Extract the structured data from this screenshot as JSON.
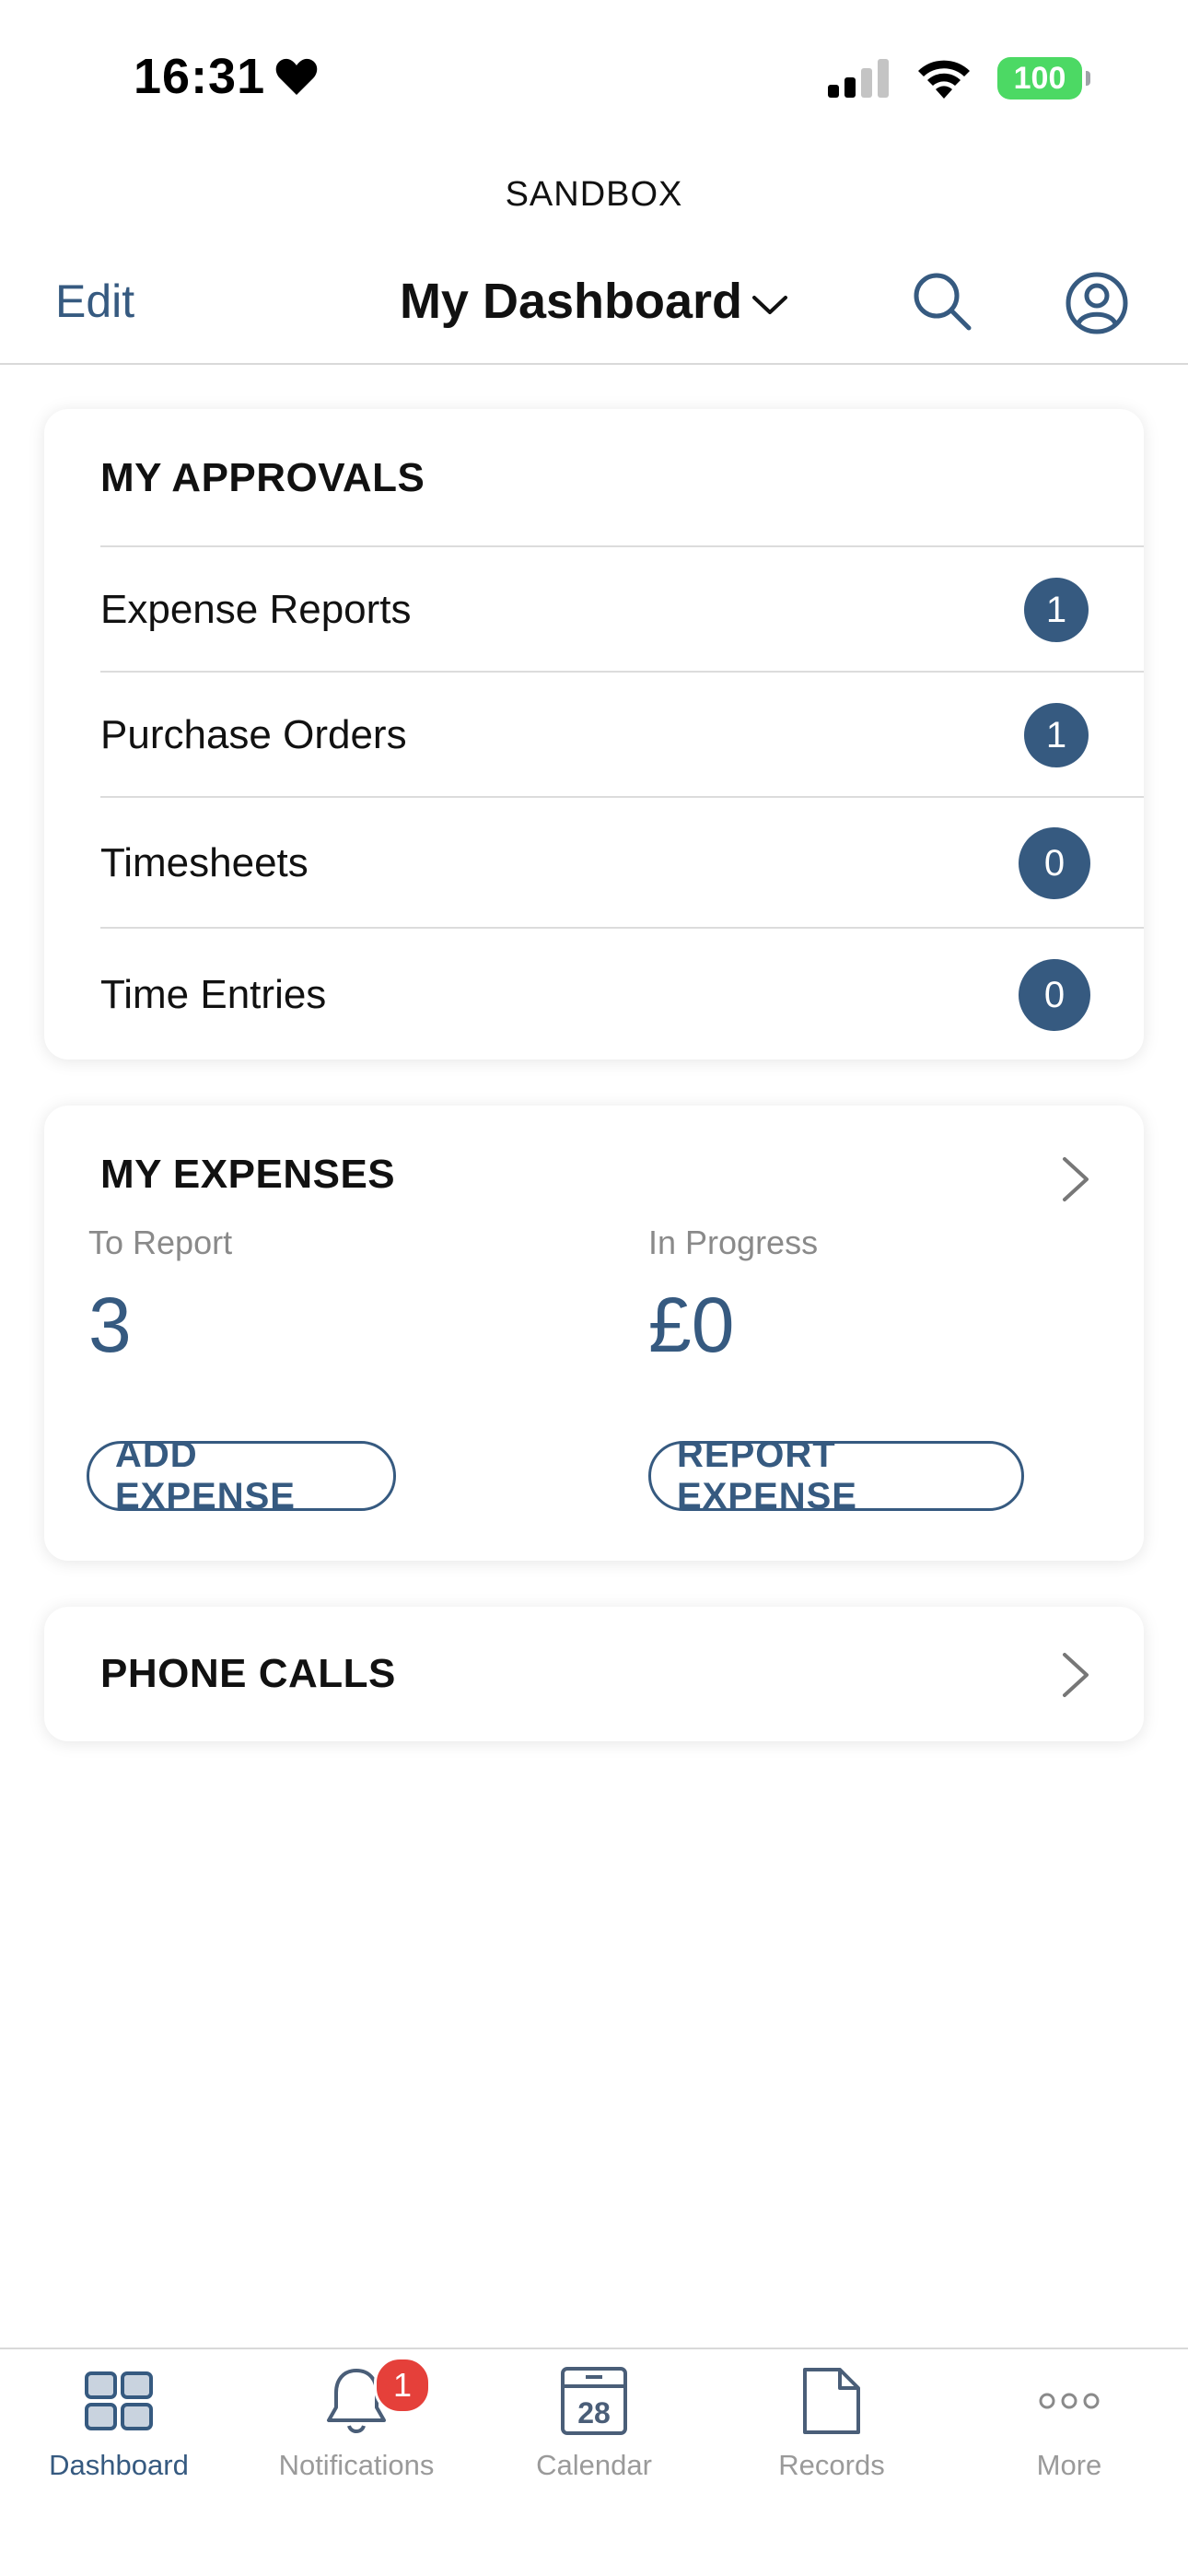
{
  "status_bar": {
    "time": "16:31",
    "battery": "100"
  },
  "environment_label": "SANDBOX",
  "nav": {
    "edit_label": "Edit",
    "title": "My Dashboard"
  },
  "approvals": {
    "heading": "MY APPROVALS",
    "items": [
      {
        "label": "Expense Reports",
        "count": "1"
      },
      {
        "label": "Purchase Orders",
        "count": "1"
      },
      {
        "label": "Timesheets",
        "count": "0"
      },
      {
        "label": "Time Entries",
        "count": "0"
      }
    ]
  },
  "expenses": {
    "heading": "MY EXPENSES",
    "to_report_label": "To Report",
    "to_report_value": "3",
    "in_progress_label": "In Progress",
    "in_progress_value": "£0",
    "add_button": "ADD EXPENSE",
    "report_button": "REPORT EXPENSE"
  },
  "phone_calls": {
    "heading": "PHONE CALLS"
  },
  "tabbar": {
    "tabs": [
      {
        "label": "Dashboard",
        "icon": "dashboard-grid-icon",
        "active": true
      },
      {
        "label": "Notifications",
        "icon": "bell-icon",
        "badge": "1"
      },
      {
        "label": "Calendar",
        "icon": "calendar-icon",
        "day": "28"
      },
      {
        "label": "Records",
        "icon": "document-icon"
      },
      {
        "label": "More",
        "icon": "more-dots-icon"
      }
    ]
  },
  "colors": {
    "accent": "#365a80",
    "badge_red": "#e5403a",
    "battery_green": "#4cd964"
  }
}
